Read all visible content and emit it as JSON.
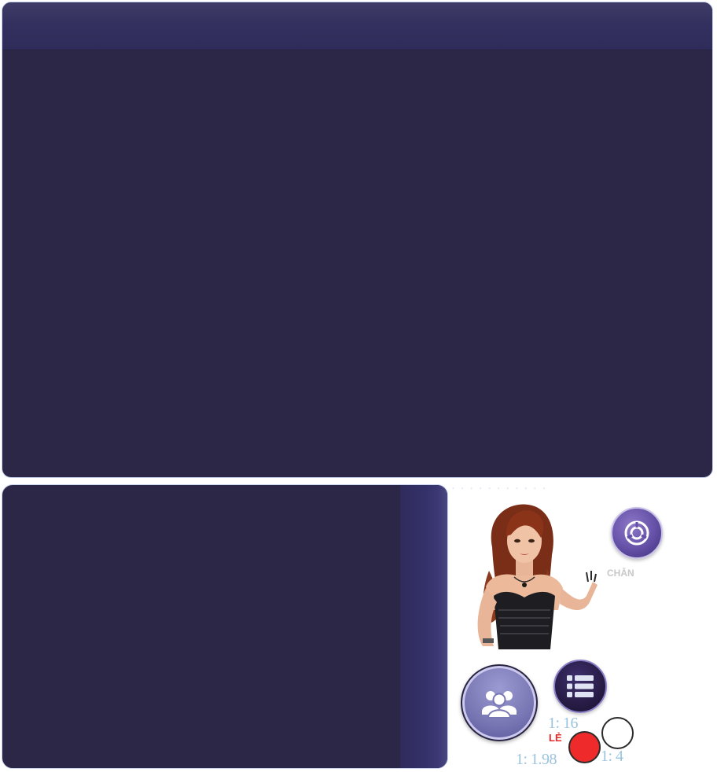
{
  "top_panel": {
    "header_color": "#33305f",
    "body_color": "#2c2746",
    "border_color": "#c9d4ee"
  },
  "bottom_panel": {
    "body_color": "#2c2746",
    "strip_color": "#34316a"
  },
  "dealer": {
    "icon": "dealer-woman-illustration"
  },
  "labels": {
    "chan": "CHẴN",
    "le": "LẺ"
  },
  "buttons": {
    "history_icon": "pie-chart-history-icon",
    "list_icon": "list-icon",
    "players_icon": "users-group-icon"
  },
  "odds": {
    "sixteen": "1: 16",
    "four": "1: 4",
    "one_ninety_eight": "1: 1.98"
  },
  "chips": {
    "white_color": "#ffffff",
    "red_color": "#ee2a2a"
  }
}
